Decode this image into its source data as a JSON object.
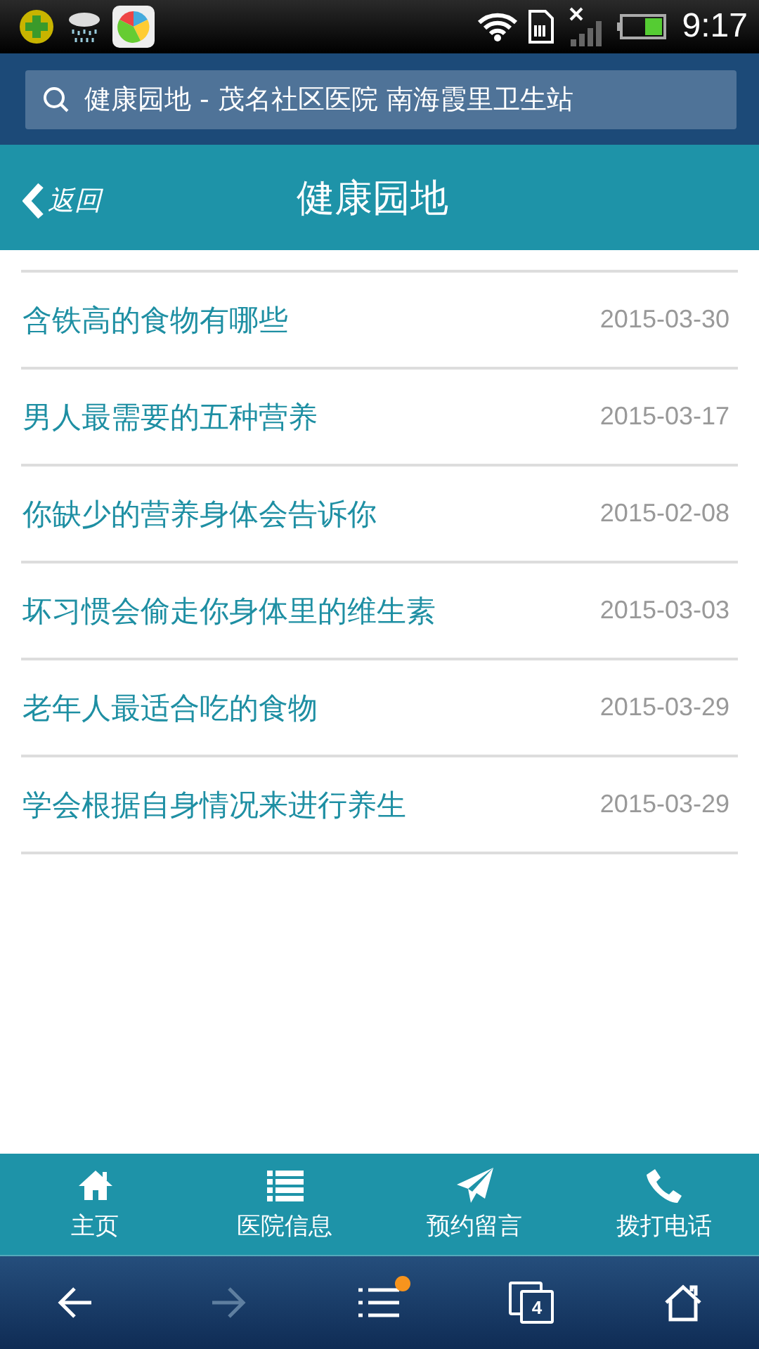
{
  "status_bar": {
    "time": "9:17"
  },
  "address_bar": {
    "value": "健康园地 - 茂名社区医院 南海霞里卫生站"
  },
  "header": {
    "back_label": "返回",
    "title": "健康园地"
  },
  "articles": [
    {
      "title": "含铁高的食物有哪些",
      "date": "2015-03-30"
    },
    {
      "title": "男人最需要的五种营养",
      "date": "2015-03-17"
    },
    {
      "title": "你缺少的营养身体会告诉你",
      "date": "2015-02-08"
    },
    {
      "title": "坏习惯会偷走你身体里的维生素",
      "date": "2015-03-03"
    },
    {
      "title": "老年人最适合吃的食物",
      "date": "2015-03-29"
    },
    {
      "title": "学会根据自身情况来进行养生",
      "date": "2015-03-29"
    }
  ],
  "bottom_nav": [
    {
      "kind": "home",
      "label": "主页"
    },
    {
      "kind": "list",
      "label": "医院信息"
    },
    {
      "kind": "send",
      "label": "预约留言"
    },
    {
      "kind": "phone",
      "label": "拨打电话"
    }
  ],
  "browser_toolbar": {
    "forward_disabled": true,
    "menu_badge": true,
    "tab_count": "4"
  }
}
